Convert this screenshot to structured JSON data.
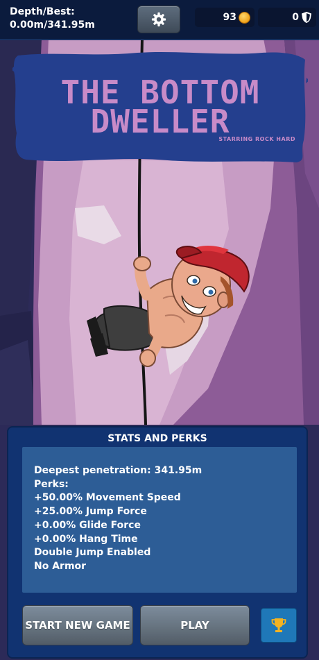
{
  "hud": {
    "depth_label": "Depth/Best:",
    "depth_value": "0.00m/341.95m",
    "coins": "93",
    "coin_icon": "coin-icon",
    "shields": "0",
    "shield_icon": "shield-icon",
    "settings_icon": "gear-icon"
  },
  "title": {
    "line1": "THE BOTTOM",
    "line2": "DWELLER",
    "subtitle": "STARRING ROCK HARD"
  },
  "panel": {
    "heading": "STATS AND PERKS",
    "lines": [
      "Deepest penetration: 341.95m",
      "Perks:",
      "+50.00% Movement Speed",
      "+25.00% Jump Force",
      "+0.00% Glide Force",
      "+0.00% Hang Time",
      "Double Jump Enabled",
      "No Armor"
    ],
    "new_game_label": "START NEW GAME",
    "play_label": "PLAY",
    "trophy_icon": "trophy-icon"
  },
  "colors": {
    "hud_bg": "#0b1b3d",
    "banner_blue": "#243f8e",
    "title_pink": "#c88bc8",
    "panel_bg": "#113371",
    "stats_bg": "#2d5d96",
    "trophy_button": "#1f78b8",
    "trophy_gold": "#f4b321",
    "cap_red": "#c0262f"
  }
}
